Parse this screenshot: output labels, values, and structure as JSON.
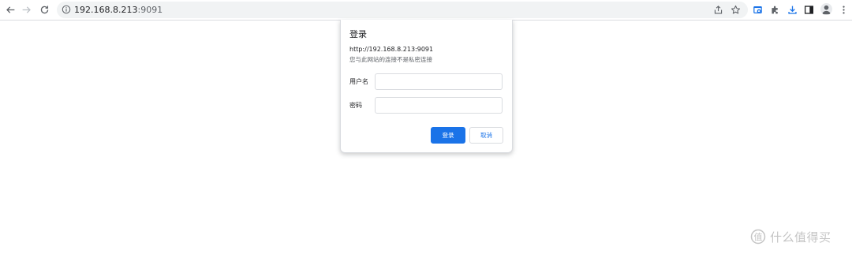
{
  "browser": {
    "url_host": "192.168.8.213",
    "url_port": ":9091"
  },
  "toolbar_icons": [
    "back-icon",
    "forward-icon",
    "reload-icon",
    "site-info-icon",
    "share-icon",
    "bookmark-star-icon",
    "extension-app-icon",
    "puzzle-extensions-icon",
    "download-icon",
    "side-panel-icon",
    "profile-avatar-icon",
    "more-menu-icon"
  ],
  "dialog": {
    "title": "登录",
    "origin": "http://192.168.8.213:9091",
    "warning": "您与此网站的连接不是私密连接",
    "username_label": "用户名",
    "username_value": "",
    "password_label": "密码",
    "password_value": "",
    "login_button": "登录",
    "cancel_button": "取消"
  },
  "watermark": {
    "text": "什么值得买"
  },
  "colors": {
    "accent": "#1a73e8",
    "toolbar_bg": "#ffffff",
    "omnibox_bg": "#f1f3f4",
    "border": "#dadce0"
  }
}
